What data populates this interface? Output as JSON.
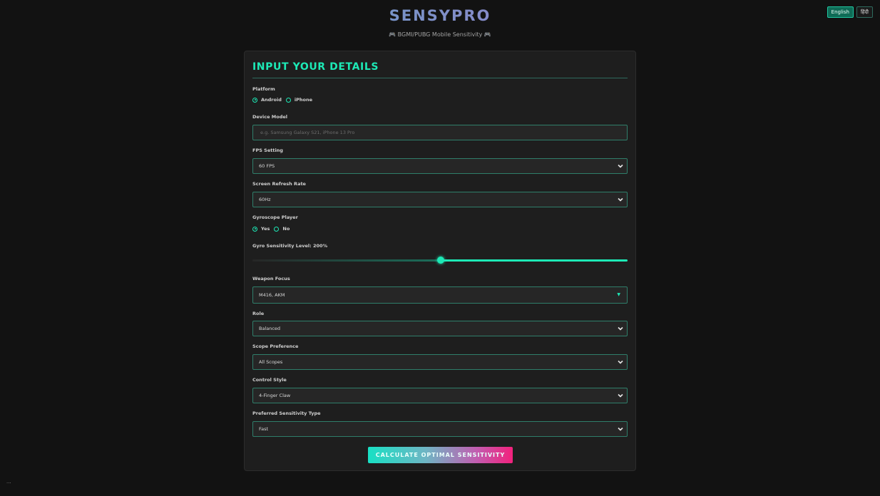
{
  "header": {
    "brand": "SENSYPRO",
    "tagline": "BGMI/PUBG Mobile Sensitivity",
    "tagline_icon": "gamepad-icon"
  },
  "languages": [
    "English",
    "हिंदी"
  ],
  "form": {
    "title": "INPUT YOUR DETAILS",
    "platform": {
      "label": "Platform",
      "options": [
        "Android",
        "iPhone"
      ],
      "selected": "Android"
    },
    "device_model": {
      "label": "Device Model",
      "value": "",
      "placeholder": "e.g. Samsung Galaxy S21, iPhone 13 Pro"
    },
    "fps": {
      "label": "FPS Setting",
      "value": "60 FPS"
    },
    "refresh_rate": {
      "label": "Screen Refresh Rate",
      "value": "60Hz"
    },
    "gyroscope": {
      "label": "Gyroscope Player",
      "options": [
        "Yes",
        "No"
      ],
      "selected": "Yes"
    },
    "gyro_level": {
      "label": "Gyro Sensitivity Level: 200%",
      "value_fraction": 0.5
    },
    "weapon_focus": {
      "label": "Weapon Focus",
      "value": "M416, AKM"
    },
    "role": {
      "label": "Role",
      "value": "Balanced"
    },
    "scope": {
      "label": "Scope Preference",
      "value": "All Scopes"
    },
    "control_style": {
      "label": "Control Style",
      "value": "4-Finger Claw"
    },
    "sensitivity_type": {
      "label": "Preferred Sensitivity Type",
      "value": "Fast"
    },
    "submit": "CALCULATE OPTIMAL SENSITIVITY"
  },
  "footer": {
    "corner": "..."
  },
  "colors": {
    "accent": "#1de9b6",
    "pink": "#f2217c",
    "background": "#121212",
    "card": "#1e1e1e"
  }
}
